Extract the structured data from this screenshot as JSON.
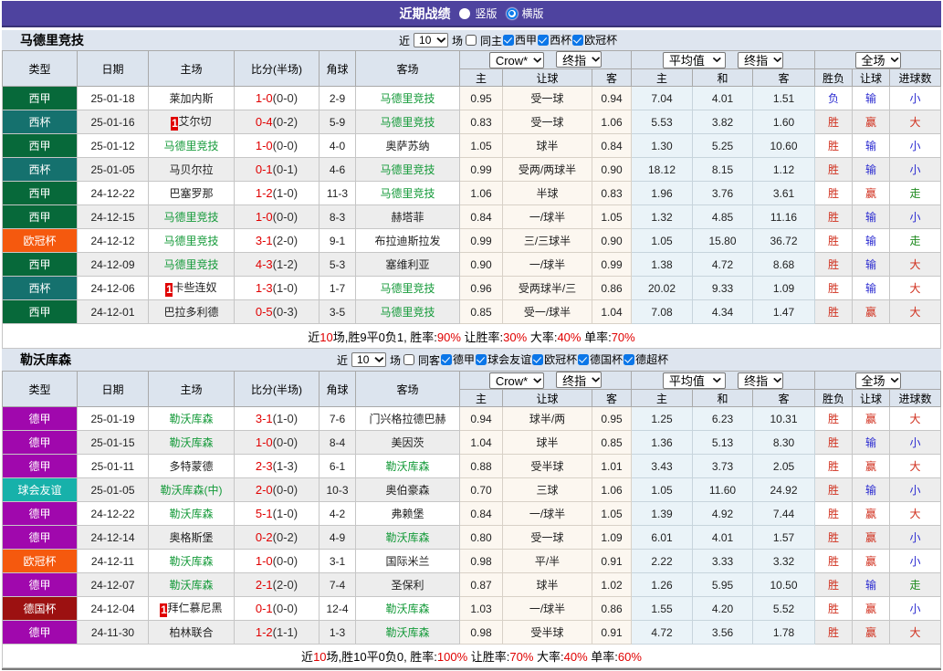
{
  "colors": {
    "topbar_background": "#4e439f",
    "accent_blue_control": "#0b76e8",
    "laliga_badge": "#07693a",
    "copa_badge": "#15716e",
    "ucl_badge": "#f5590e",
    "bundesliga_badge": "#a008ad",
    "friendly_badge": "#17b1aa",
    "dfb_pokal_badge": "#9c1111",
    "score_red": "#e00000",
    "team_green": "#149a39",
    "result_red": "#d02e1c",
    "result_blue": "#2a2ad0",
    "result_green": "#1e8a1e"
  },
  "topbar": {
    "title": "近期战绩",
    "radios": [
      {
        "label": "竖版",
        "checked": false
      },
      {
        "label": "横版",
        "checked": true
      }
    ]
  },
  "sections": [
    {
      "team": "马德里竞技",
      "filter": {
        "near": "近",
        "count": "10",
        "games": "场",
        "same": "同主",
        "comps": [
          "西甲",
          "西杯",
          "欧冠杯"
        ]
      },
      "header": {
        "cols": [
          "类型",
          "日期",
          "主场",
          "比分(半场)",
          "角球",
          "客场"
        ],
        "sel_odds": [
          "Crow*",
          "终指"
        ],
        "sel_avg": [
          "平均值",
          "终指"
        ],
        "sel_result": "全场",
        "sub": [
          "主",
          "让球",
          "客",
          "主",
          "和",
          "客",
          "胜负",
          "让球",
          "进球数"
        ]
      },
      "rows": [
        {
          "comp": "西甲",
          "compc": "c-xijia",
          "date": "25-01-18",
          "hcard": null,
          "hteam": "莱加内斯",
          "hclass": null,
          "score": "1-0",
          "half": "(0-0)",
          "corner": "2-9",
          "acard": null,
          "ateam": "马德里竞技",
          "aclass": "green",
          "o1": "0.95",
          "hc": "受一球",
          "o2": "0.94",
          "a1": "7.04",
          "a2": "4.01",
          "a3": "1.51",
          "r1": "负",
          "r1c": "blue",
          "r2": "输",
          "r2c": "blue",
          "r3": "小",
          "r3c": "blue"
        },
        {
          "comp": "西杯",
          "compc": "c-xibei",
          "date": "25-01-16",
          "hcard": "1",
          "hteam": "艾尔切",
          "hclass": null,
          "score": "0-4",
          "half": "(0-2)",
          "corner": "5-9",
          "acard": null,
          "ateam": "马德里竞技",
          "aclass": "green",
          "o1": "0.83",
          "hc": "受一球",
          "o2": "1.06",
          "a1": "5.53",
          "a2": "3.82",
          "a3": "1.60",
          "r1": "胜",
          "r1c": "red",
          "r2": "赢",
          "r2c": "red",
          "r3": "大",
          "r3c": "red"
        },
        {
          "comp": "西甲",
          "compc": "c-xijia",
          "date": "25-01-12",
          "hcard": null,
          "hteam": "马德里竞技",
          "hclass": "green",
          "score": "1-0",
          "half": "(0-0)",
          "corner": "4-0",
          "acard": null,
          "ateam": "奥萨苏纳",
          "aclass": null,
          "o1": "1.05",
          "hc": "球半",
          "o2": "0.84",
          "a1": "1.30",
          "a2": "5.25",
          "a3": "10.60",
          "r1": "胜",
          "r1c": "red",
          "r2": "输",
          "r2c": "blue",
          "r3": "小",
          "r3c": "blue"
        },
        {
          "comp": "西杯",
          "compc": "c-xibei",
          "date": "25-01-05",
          "hcard": null,
          "hteam": "马贝尔拉",
          "hclass": null,
          "score": "0-1",
          "half": "(0-1)",
          "corner": "4-6",
          "acard": null,
          "ateam": "马德里竞技",
          "aclass": "green",
          "o1": "0.99",
          "hc": "受两/两球半",
          "o2": "0.90",
          "a1": "18.12",
          "a2": "8.15",
          "a3": "1.12",
          "r1": "胜",
          "r1c": "red",
          "r2": "输",
          "r2c": "blue",
          "r3": "小",
          "r3c": "blue"
        },
        {
          "comp": "西甲",
          "compc": "c-xijia",
          "date": "24-12-22",
          "hcard": null,
          "hteam": "巴塞罗那",
          "hclass": null,
          "score": "1-2",
          "half": "(1-0)",
          "corner": "11-3",
          "acard": null,
          "ateam": "马德里竞技",
          "aclass": "green",
          "o1": "1.06",
          "hc": "半球",
          "o2": "0.83",
          "a1": "1.96",
          "a2": "3.76",
          "a3": "3.61",
          "r1": "胜",
          "r1c": "red",
          "r2": "赢",
          "r2c": "red",
          "r3": "走",
          "r3c": "walk"
        },
        {
          "comp": "西甲",
          "compc": "c-xijia",
          "date": "24-12-15",
          "hcard": null,
          "hteam": "马德里竞技",
          "hclass": "green",
          "score": "1-0",
          "half": "(0-0)",
          "corner": "8-3",
          "acard": null,
          "ateam": "赫塔菲",
          "aclass": null,
          "o1": "0.84",
          "hc": "一/球半",
          "o2": "1.05",
          "a1": "1.32",
          "a2": "4.85",
          "a3": "11.16",
          "r1": "胜",
          "r1c": "red",
          "r2": "输",
          "r2c": "blue",
          "r3": "小",
          "r3c": "blue"
        },
        {
          "comp": "欧冠杯",
          "compc": "c-ouguan",
          "date": "24-12-12",
          "hcard": null,
          "hteam": "马德里竞技",
          "hclass": "green",
          "score": "3-1",
          "half": "(2-0)",
          "corner": "9-1",
          "acard": null,
          "ateam": "布拉迪斯拉发",
          "aclass": null,
          "o1": "0.99",
          "hc": "三/三球半",
          "o2": "0.90",
          "a1": "1.05",
          "a2": "15.80",
          "a3": "36.72",
          "r1": "胜",
          "r1c": "red",
          "r2": "输",
          "r2c": "blue",
          "r3": "走",
          "r3c": "walk"
        },
        {
          "comp": "西甲",
          "compc": "c-xijia",
          "date": "24-12-09",
          "hcard": null,
          "hteam": "马德里竞技",
          "hclass": "green",
          "score": "4-3",
          "half": "(1-2)",
          "corner": "5-3",
          "acard": null,
          "ateam": "塞维利亚",
          "aclass": null,
          "o1": "0.90",
          "hc": "一/球半",
          "o2": "0.99",
          "a1": "1.38",
          "a2": "4.72",
          "a3": "8.68",
          "r1": "胜",
          "r1c": "red",
          "r2": "输",
          "r2c": "blue",
          "r3": "大",
          "r3c": "red"
        },
        {
          "comp": "西杯",
          "compc": "c-xibei",
          "date": "24-12-06",
          "hcard": "1",
          "hteam": "卡些连奴",
          "hclass": null,
          "score": "1-3",
          "half": "(1-0)",
          "corner": "1-7",
          "acard": null,
          "ateam": "马德里竞技",
          "aclass": "green",
          "o1": "0.96",
          "hc": "受两球半/三",
          "o2": "0.86",
          "a1": "20.02",
          "a2": "9.33",
          "a3": "1.09",
          "r1": "胜",
          "r1c": "red",
          "r2": "输",
          "r2c": "blue",
          "r3": "大",
          "r3c": "red"
        },
        {
          "comp": "西甲",
          "compc": "c-xijia",
          "date": "24-12-01",
          "hcard": null,
          "hteam": "巴拉多利德",
          "hclass": null,
          "score": "0-5",
          "half": "(0-3)",
          "corner": "3-5",
          "acard": null,
          "ateam": "马德里竞技",
          "aclass": "green",
          "o1": "0.85",
          "hc": "受一/球半",
          "o2": "1.04",
          "a1": "7.08",
          "a2": "4.34",
          "a3": "1.47",
          "r1": "胜",
          "r1c": "red",
          "r2": "赢",
          "r2c": "red",
          "r3": "大",
          "r3c": "red"
        }
      ],
      "summary": [
        {
          "t": "近",
          "c": null
        },
        {
          "t": "10",
          "c": "red"
        },
        {
          "t": "场,胜9平0负1, 胜率:",
          "c": null
        },
        {
          "t": "90%",
          "c": "red"
        },
        {
          "t": " 让胜率:",
          "c": null
        },
        {
          "t": "30%",
          "c": "red"
        },
        {
          "t": " 大率:",
          "c": null
        },
        {
          "t": "40%",
          "c": "red"
        },
        {
          "t": " 单率:",
          "c": null
        },
        {
          "t": "70%",
          "c": "red"
        }
      ]
    },
    {
      "team": "勒沃库森",
      "filter": {
        "near": "近",
        "count": "10",
        "games": "场",
        "same": "同客",
        "comps": [
          "德甲",
          "球会友谊",
          "欧冠杯",
          "德国杯",
          "德超杯"
        ]
      },
      "header": {
        "cols": [
          "类型",
          "日期",
          "主场",
          "比分(半场)",
          "角球",
          "客场"
        ],
        "sel_odds": [
          "Crow*",
          "终指"
        ],
        "sel_avg": [
          "平均值",
          "终指"
        ],
        "sel_result": "全场",
        "sub": [
          "主",
          "让球",
          "客",
          "主",
          "和",
          "客",
          "胜负",
          "让球",
          "进球数"
        ]
      },
      "rows": [
        {
          "comp": "德甲",
          "compc": "c-dejia",
          "date": "25-01-19",
          "hcard": null,
          "hteam": "勒沃库森",
          "hclass": "green",
          "score": "3-1",
          "half": "(1-0)",
          "corner": "7-6",
          "acard": null,
          "ateam": "门兴格拉德巴赫",
          "aclass": null,
          "o1": "0.94",
          "hc": "球半/两",
          "o2": "0.95",
          "a1": "1.25",
          "a2": "6.23",
          "a3": "10.31",
          "r1": "胜",
          "r1c": "red",
          "r2": "赢",
          "r2c": "red",
          "r3": "大",
          "r3c": "red"
        },
        {
          "comp": "德甲",
          "compc": "c-dejia",
          "date": "25-01-15",
          "hcard": null,
          "hteam": "勒沃库森",
          "hclass": "green",
          "score": "1-0",
          "half": "(0-0)",
          "corner": "8-4",
          "acard": null,
          "ateam": "美因茨",
          "aclass": null,
          "o1": "1.04",
          "hc": "球半",
          "o2": "0.85",
          "a1": "1.36",
          "a2": "5.13",
          "a3": "8.30",
          "r1": "胜",
          "r1c": "red",
          "r2": "输",
          "r2c": "blue",
          "r3": "小",
          "r3c": "blue"
        },
        {
          "comp": "德甲",
          "compc": "c-dejia",
          "date": "25-01-11",
          "hcard": null,
          "hteam": "多特蒙德",
          "hclass": null,
          "score": "2-3",
          "half": "(1-3)",
          "corner": "6-1",
          "acard": null,
          "ateam": "勒沃库森",
          "aclass": "green",
          "o1": "0.88",
          "hc": "受半球",
          "o2": "1.01",
          "a1": "3.43",
          "a2": "3.73",
          "a3": "2.05",
          "r1": "胜",
          "r1c": "red",
          "r2": "赢",
          "r2c": "red",
          "r3": "大",
          "r3c": "red"
        },
        {
          "comp": "球会友谊",
          "compc": "c-qiuhui",
          "date": "25-01-05",
          "hcard": null,
          "hteam": "勒沃库森(中)",
          "hclass": "green",
          "score": "2-0",
          "half": "(0-0)",
          "corner": "10-3",
          "acard": null,
          "ateam": "奥伯豪森",
          "aclass": null,
          "o1": "0.70",
          "hc": "三球",
          "o2": "1.06",
          "a1": "1.05",
          "a2": "11.60",
          "a3": "24.92",
          "r1": "胜",
          "r1c": "red",
          "r2": "输",
          "r2c": "blue",
          "r3": "小",
          "r3c": "blue"
        },
        {
          "comp": "德甲",
          "compc": "c-dejia",
          "date": "24-12-22",
          "hcard": null,
          "hteam": "勒沃库森",
          "hclass": "green",
          "score": "5-1",
          "half": "(1-0)",
          "corner": "4-2",
          "acard": null,
          "ateam": "弗赖堡",
          "aclass": null,
          "o1": "0.84",
          "hc": "一/球半",
          "o2": "1.05",
          "a1": "1.39",
          "a2": "4.92",
          "a3": "7.44",
          "r1": "胜",
          "r1c": "red",
          "r2": "赢",
          "r2c": "red",
          "r3": "大",
          "r3c": "red"
        },
        {
          "comp": "德甲",
          "compc": "c-dejia",
          "date": "24-12-14",
          "hcard": null,
          "hteam": "奥格斯堡",
          "hclass": null,
          "score": "0-2",
          "half": "(0-2)",
          "corner": "4-9",
          "acard": null,
          "ateam": "勒沃库森",
          "aclass": "green",
          "o1": "0.80",
          "hc": "受一球",
          "o2": "1.09",
          "a1": "6.01",
          "a2": "4.01",
          "a3": "1.57",
          "r1": "胜",
          "r1c": "red",
          "r2": "赢",
          "r2c": "red",
          "r3": "小",
          "r3c": "blue"
        },
        {
          "comp": "欧冠杯",
          "compc": "c-ouguan",
          "date": "24-12-11",
          "hcard": null,
          "hteam": "勒沃库森",
          "hclass": "green",
          "score": "1-0",
          "half": "(0-0)",
          "corner": "3-1",
          "acard": null,
          "ateam": "国际米兰",
          "aclass": null,
          "o1": "0.98",
          "hc": "平/半",
          "o2": "0.91",
          "a1": "2.22",
          "a2": "3.33",
          "a3": "3.32",
          "r1": "胜",
          "r1c": "red",
          "r2": "赢",
          "r2c": "red",
          "r3": "小",
          "r3c": "blue"
        },
        {
          "comp": "德甲",
          "compc": "c-dejia",
          "date": "24-12-07",
          "hcard": null,
          "hteam": "勒沃库森",
          "hclass": "green",
          "score": "2-1",
          "half": "(2-0)",
          "corner": "7-4",
          "acard": null,
          "ateam": "圣保利",
          "aclass": null,
          "o1": "0.87",
          "hc": "球半",
          "o2": "1.02",
          "a1": "1.26",
          "a2": "5.95",
          "a3": "10.50",
          "r1": "胜",
          "r1c": "red",
          "r2": "输",
          "r2c": "blue",
          "r3": "走",
          "r3c": "walk"
        },
        {
          "comp": "德国杯",
          "compc": "c-degb",
          "date": "24-12-04",
          "hcard": "1",
          "hteam": "拜仁慕尼黑",
          "hclass": null,
          "score": "0-1",
          "half": "(0-0)",
          "corner": "12-4",
          "acard": null,
          "ateam": "勒沃库森",
          "aclass": "green",
          "o1": "1.03",
          "hc": "一/球半",
          "o2": "0.86",
          "a1": "1.55",
          "a2": "4.20",
          "a3": "5.52",
          "r1": "胜",
          "r1c": "red",
          "r2": "赢",
          "r2c": "red",
          "r3": "小",
          "r3c": "blue"
        },
        {
          "comp": "德甲",
          "compc": "c-dejia",
          "date": "24-11-30",
          "hcard": null,
          "hteam": "柏林联合",
          "hclass": null,
          "score": "1-2",
          "half": "(1-1)",
          "corner": "1-3",
          "acard": null,
          "ateam": "勒沃库森",
          "aclass": "green",
          "o1": "0.98",
          "hc": "受半球",
          "o2": "0.91",
          "a1": "4.72",
          "a2": "3.56",
          "a3": "1.78",
          "r1": "胜",
          "r1c": "red",
          "r2": "赢",
          "r2c": "red",
          "r3": "大",
          "r3c": "red"
        }
      ],
      "summary": [
        {
          "t": "近",
          "c": null
        },
        {
          "t": "10",
          "c": "red"
        },
        {
          "t": "场,胜10平0负0, 胜率:",
          "c": null
        },
        {
          "t": "100%",
          "c": "red"
        },
        {
          "t": " 让胜率:",
          "c": null
        },
        {
          "t": "70%",
          "c": "red"
        },
        {
          "t": " 大率:",
          "c": null
        },
        {
          "t": "40%",
          "c": "red"
        },
        {
          "t": " 单率:",
          "c": null
        },
        {
          "t": "60%",
          "c": "red"
        }
      ]
    }
  ]
}
